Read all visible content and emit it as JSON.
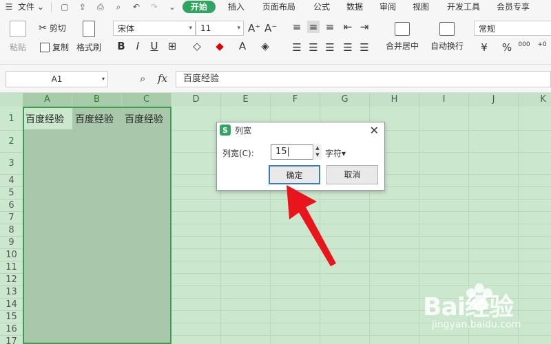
{
  "menubar": {
    "file_label": "文件",
    "tabs": [
      "开始",
      "插入",
      "页面布局",
      "公式",
      "数据",
      "审阅",
      "视图",
      "开发工具",
      "会员专享"
    ]
  },
  "ribbon": {
    "paste": "粘贴",
    "cut": "剪切",
    "copy": "复制",
    "format_painter": "格式刷",
    "font_name": "宋体",
    "font_size": "11",
    "merge_center": "合并居中",
    "wrap_text": "自动换行",
    "number_format": "常规",
    "currency": "¥",
    "percent": "%"
  },
  "formula_bar": {
    "name_box": "A1",
    "fx": "fx",
    "content": "百度经验"
  },
  "grid": {
    "columns": [
      "A",
      "B",
      "C",
      "D",
      "E",
      "F",
      "G",
      "H",
      "I",
      "J",
      "K"
    ],
    "rows": [
      "1",
      "2",
      "3",
      "4",
      "5",
      "6",
      "7",
      "8",
      "9",
      "10",
      "11",
      "12",
      "13",
      "14",
      "15",
      "16",
      "17"
    ],
    "cells": {
      "A1": "百度经验",
      "B1": "百度经验",
      "C1": "百度经验"
    }
  },
  "dialog": {
    "title": "列宽",
    "label": "列宽(C):",
    "value": "15",
    "unit": "字符▾",
    "ok": "确定",
    "cancel": "取消"
  },
  "watermark": {
    "brand": "Bai经验",
    "url": "jingyan.baidu.com"
  },
  "colors": {
    "accent": "#2fa55f",
    "grid_bg": "#cbe8cf",
    "arrow": "#e8151c"
  }
}
